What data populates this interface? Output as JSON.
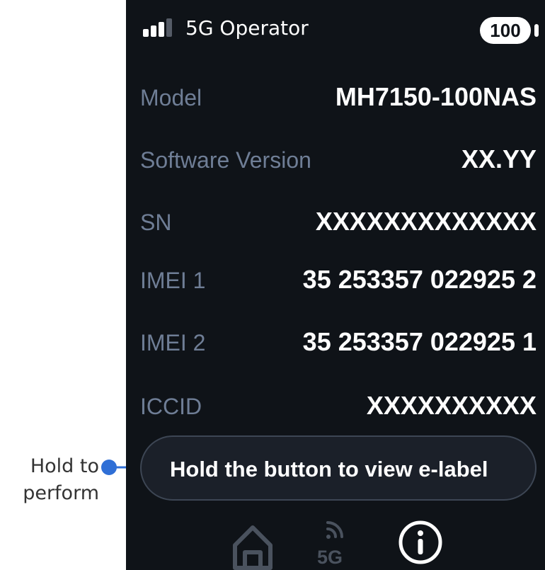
{
  "annotation": {
    "line1": "Hold to",
    "line2": "perform",
    "accent_color": "#2f6fd6"
  },
  "status_bar": {
    "operator": "5G Operator",
    "battery_level": "100",
    "signal_icon": "signal-bars-icon"
  },
  "info_rows": [
    {
      "label": "Model",
      "value": "MH7150-100NAS"
    },
    {
      "label": "Software Version",
      "value": "XX.YY"
    },
    {
      "label": "SN",
      "value": "XXXXXXXXXXXXX"
    },
    {
      "label": "IMEI 1",
      "value": "35 253357 022925 2"
    },
    {
      "label": "IMEI 2",
      "value": "35 253357 022925 1"
    },
    {
      "label": "ICCID",
      "value": "XXXXXXXXXX"
    }
  ],
  "elabel_button": {
    "label": "Hold the button to view e-label"
  },
  "nav": {
    "home_icon": "home-icon",
    "fiveg_label": "5G",
    "info_icon": "info-icon",
    "active_tab": "info"
  },
  "colors": {
    "screen_bg": "#0f1318",
    "label": "#6f7e96",
    "value": "#ffffff",
    "inactive_icon": "#4a525e"
  }
}
